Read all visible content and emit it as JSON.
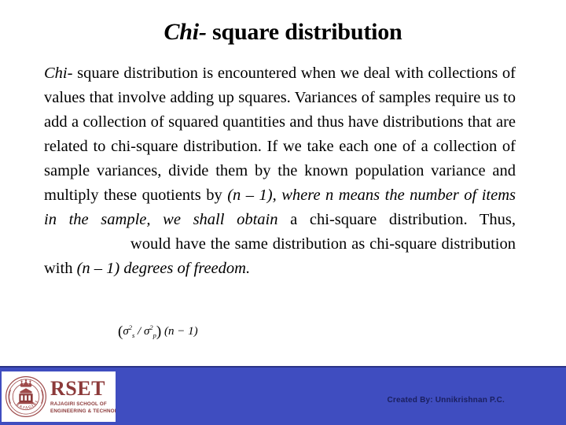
{
  "slide": {
    "title": {
      "italic_part": "Chi-",
      "rest_part": " square distribution"
    },
    "body": {
      "paragraph_run_1": "Chi-",
      "paragraph_run_2": " square distribution is encountered when we deal with collections of values that involve adding up squares. Variances of samples require us to add a collection of squared quantities and thus have distributions that are related to chi-square distribution. If we take each one of a collection of sample variances, divide them by the known population variance and multiply these quotients by ",
      "paragraph_run_3_italic": "(n – 1), where n means the number of items in the sample, we shall obtain",
      "paragraph_run_4": " a chi-square distribution. Thus, ",
      "paragraph_run_5": " would have the same distribution as chi-square distribution with ",
      "paragraph_run_6_italic": "(n – 1) degrees of freedom."
    },
    "formula": {
      "open_paren": "(",
      "sigma_sample": "σ",
      "sigma_sample_sup": "2",
      "sigma_sample_sub": "s",
      "divider": " / ",
      "sigma_pop": "σ",
      "sigma_pop_sup": "2",
      "sigma_pop_sub": "p",
      "close_paren": ")",
      "factor": " (n − 1)"
    },
    "footer": {
      "credit": "Created By: Unnikrishnan P.C.",
      "band_color": "#3F4DC0",
      "band_border_color": "#2A3386",
      "credit_color": "#1A1F5E"
    },
    "logo": {
      "wordmark": "RSET",
      "subtitle_line1": "RAJAGIRI SCHOOL OF",
      "subtitle_line2": "ENGINEERING & TECHNOLOGY",
      "crest_motto": "RAJAGIRI",
      "brand_color": "#8C3A3A"
    }
  }
}
